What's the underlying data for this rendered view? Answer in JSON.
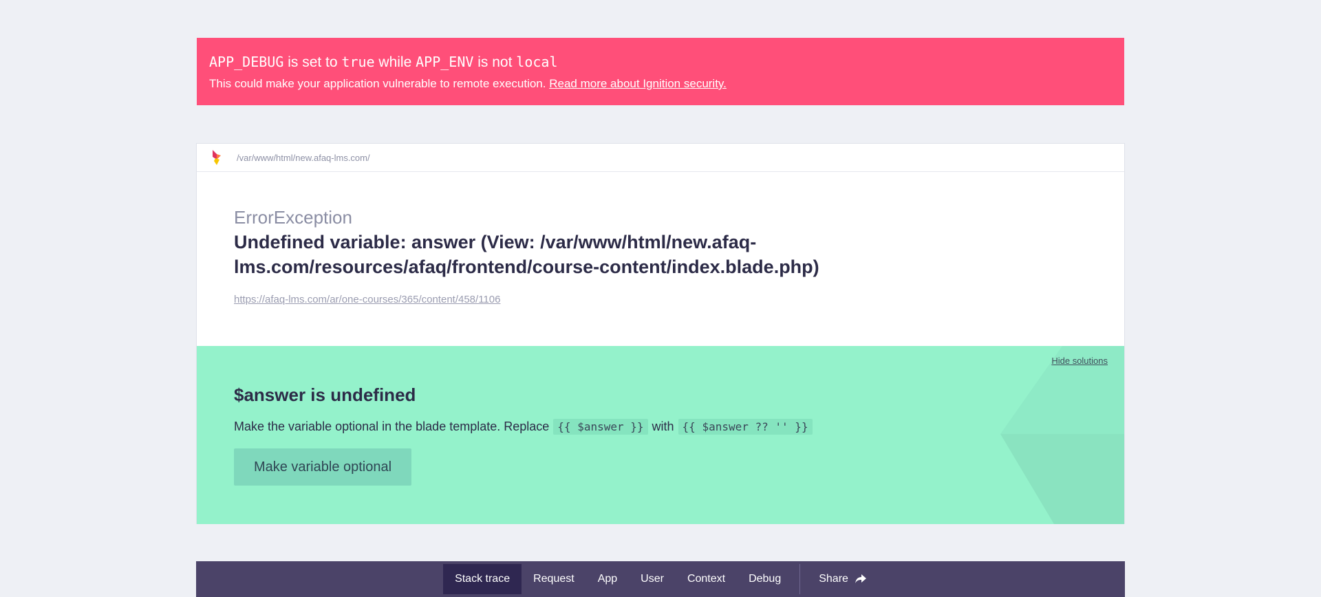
{
  "banner": {
    "k1": "APP_DEBUG",
    "t1": " is set to ",
    "k2": "true",
    "t2": " while ",
    "k3": "APP_ENV",
    "t3": " is not ",
    "k4": "local",
    "message": "This could make your application vulnerable to remote execution.",
    "link": "Read more about Ignition security."
  },
  "header": {
    "logo_icon": "ignition-logo-icon",
    "path": "/var/www/html/new.afaq-lms.com/"
  },
  "error": {
    "class": "ErrorException",
    "message": "Undefined variable: answer (View: /var/www/html/new.afaq-lms.com/resources/afaq/frontend/course-content/index.blade.php)",
    "url": "https://afaq-lms.com/ar/one-courses/365/content/458/1106"
  },
  "solution": {
    "hide_label": "Hide solutions",
    "title": "$answer is undefined",
    "text_before": "Make the variable optional in the blade template. Replace",
    "code_1": "{{ $answer }}",
    "text_mid": "with",
    "code_2": "{{ $answer ?? '' }}",
    "button_label": "Make variable optional"
  },
  "nav": {
    "items": [
      "Stack trace",
      "Request",
      "App",
      "User",
      "Context",
      "Debug"
    ],
    "active": "Stack trace",
    "share_label": "Share",
    "share_icon": "share-arrow-icon"
  },
  "colors": {
    "banner": "#ff4f79",
    "solution": "#94f2cb",
    "nav": "#4b4368",
    "nav_active": "#2f2751"
  }
}
